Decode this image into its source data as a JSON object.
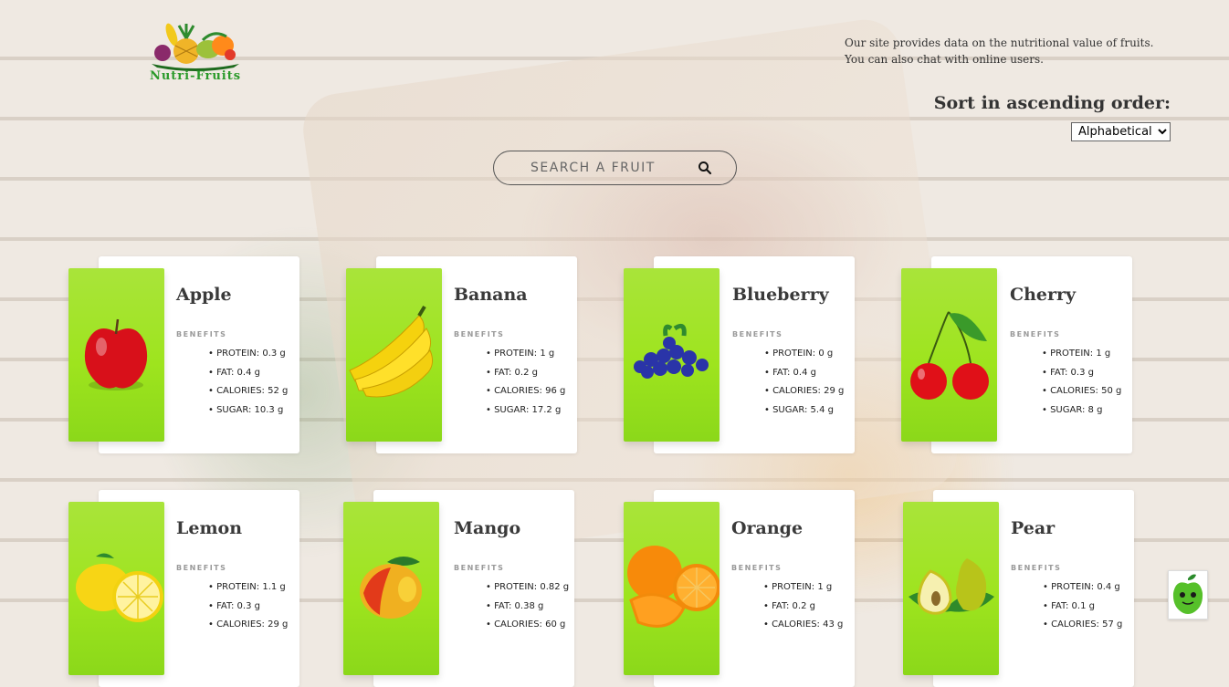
{
  "logo": {
    "text": "Nutri-Fruits"
  },
  "tagline": {
    "line1": "Our site provides data on the nutritional value of fruits.",
    "line2": "You can also chat with online users."
  },
  "sort": {
    "label": "Sort in ascending order:",
    "selected": "Alphabetical"
  },
  "search": {
    "placeholder": "SEARCH A FRUIT"
  },
  "benefits_label": "BENEFITS",
  "fruits": [
    {
      "name": "Apple",
      "protein": "PROTEIN: 0.3 g",
      "fat": "FAT: 0.4 g",
      "calories": "CALORIES: 52 g",
      "sugar": "SUGAR: 10.3 g"
    },
    {
      "name": "Banana",
      "protein": "PROTEIN: 1 g",
      "fat": "FAT: 0.2 g",
      "calories": "CALORIES: 96 g",
      "sugar": "SUGAR: 17.2 g"
    },
    {
      "name": "Blueberry",
      "protein": "PROTEIN: 0 g",
      "fat": "FAT: 0.4 g",
      "calories": "CALORIES: 29 g",
      "sugar": "SUGAR: 5.4 g"
    },
    {
      "name": "Cherry",
      "protein": "PROTEIN: 1 g",
      "fat": "FAT: 0.3 g",
      "calories": "CALORIES: 50 g",
      "sugar": "SUGAR: 8 g"
    },
    {
      "name": "Lemon",
      "protein": "PROTEIN: 1.1 g",
      "fat": "FAT: 0.3 g",
      "calories": "CALORIES: 29 g",
      "sugar": ""
    },
    {
      "name": "Mango",
      "protein": "PROTEIN: 0.82 g",
      "fat": "FAT: 0.38 g",
      "calories": "CALORIES: 60 g",
      "sugar": ""
    },
    {
      "name": "Orange",
      "protein": "PROTEIN: 1 g",
      "fat": "FAT: 0.2 g",
      "calories": "CALORIES: 43 g",
      "sugar": ""
    },
    {
      "name": "Pear",
      "protein": "PROTEIN: 0.4 g",
      "fat": "FAT: 0.1 g",
      "calories": "CALORIES: 57 g",
      "sugar": ""
    }
  ],
  "colors": {
    "accent_green": "#9ee41e",
    "logo_green": "#2a9a2a"
  }
}
